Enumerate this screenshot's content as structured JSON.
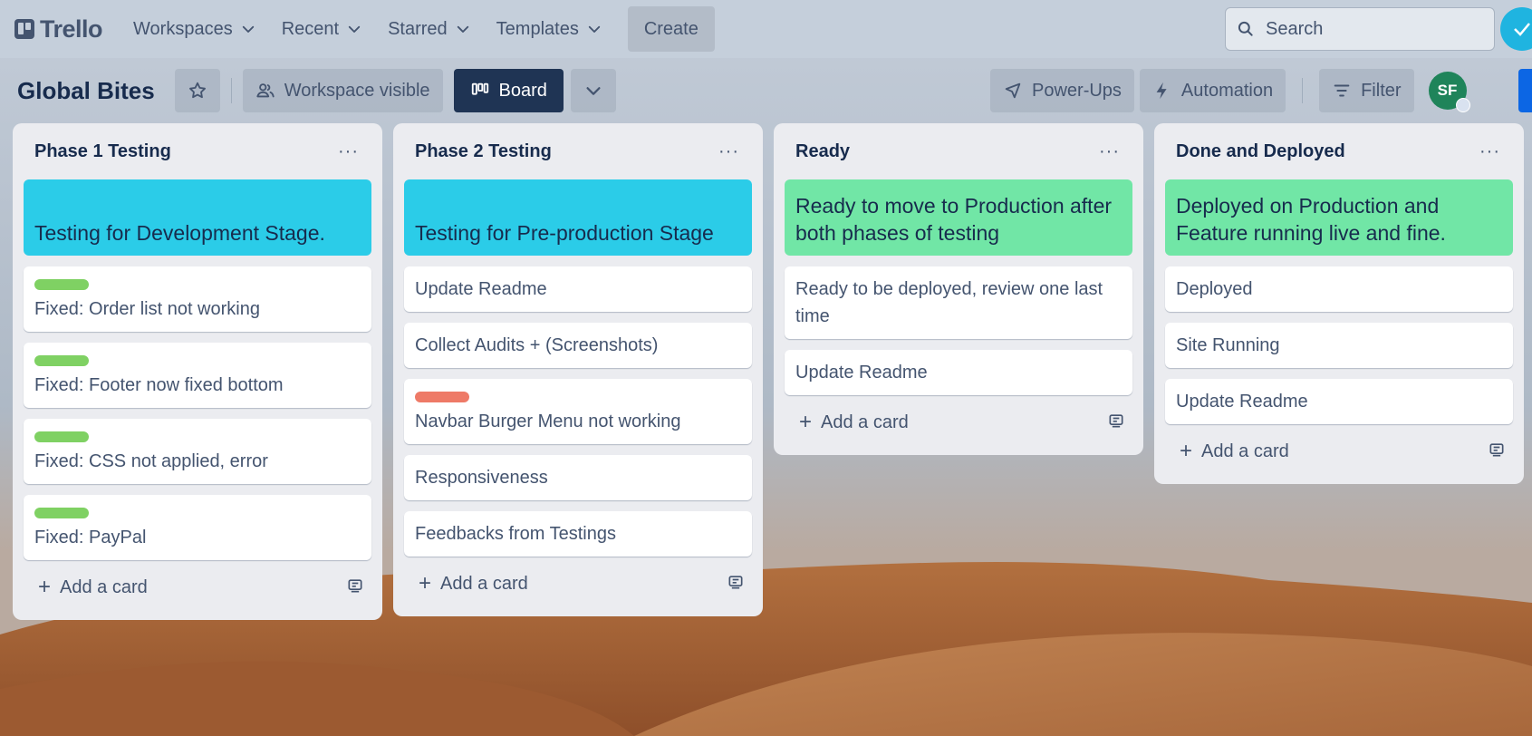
{
  "app": {
    "logo_text": "Trello"
  },
  "nav": {
    "items": [
      {
        "label": "Workspaces"
      },
      {
        "label": "Recent"
      },
      {
        "label": "Starred"
      },
      {
        "label": "Templates"
      }
    ],
    "create_label": "Create",
    "search_placeholder": "Search"
  },
  "board": {
    "title": "Global Bites",
    "visibility_label": "Workspace visible",
    "view_label": "Board",
    "powerups_label": "Power-Ups",
    "automation_label": "Automation",
    "filter_label": "Filter",
    "avatar_initials": "SF"
  },
  "lists": [
    {
      "title": "Phase 1 Testing",
      "menu": "···",
      "cover": {
        "text": "Testing for Development Stage.",
        "color": "#2bcce8"
      },
      "cards": [
        {
          "label_color": "green",
          "text": "Fixed: Order list not working"
        },
        {
          "label_color": "green",
          "text": "Fixed: Footer now fixed bottom"
        },
        {
          "label_color": "green",
          "text": "Fixed: CSS not applied, error"
        },
        {
          "label_color": "green",
          "text": "Fixed: PayPal"
        }
      ],
      "add_label": "Add a card"
    },
    {
      "title": "Phase 2 Testing",
      "menu": "···",
      "cover": {
        "text": "Testing for Pre-production Stage",
        "color": "#2bcce8"
      },
      "cards": [
        {
          "text": "Update Readme"
        },
        {
          "text": "Collect Audits + (Screenshots)"
        },
        {
          "label_color": "red",
          "text": "Navbar Burger Menu not working"
        },
        {
          "text": "Responsiveness"
        },
        {
          "text": "Feedbacks from Testings"
        }
      ],
      "add_label": "Add a card"
    },
    {
      "title": "Ready",
      "menu": "···",
      "cover": {
        "text": "Ready to move to Production after both phases of testing",
        "color": "#71e6a6"
      },
      "cards": [
        {
          "text": "Ready to be deployed, review one last time"
        },
        {
          "text": "Update Readme"
        }
      ],
      "add_label": "Add a card"
    },
    {
      "title": "Done and Deployed",
      "menu": "···",
      "cover": {
        "text": "Deployed on Production and Feature running live and fine.",
        "color": "#71e6a6"
      },
      "cards": [
        {
          "text": "Deployed"
        },
        {
          "text": "Site Running"
        },
        {
          "text": "Update Readme"
        }
      ],
      "add_label": "Add a card"
    }
  ]
}
